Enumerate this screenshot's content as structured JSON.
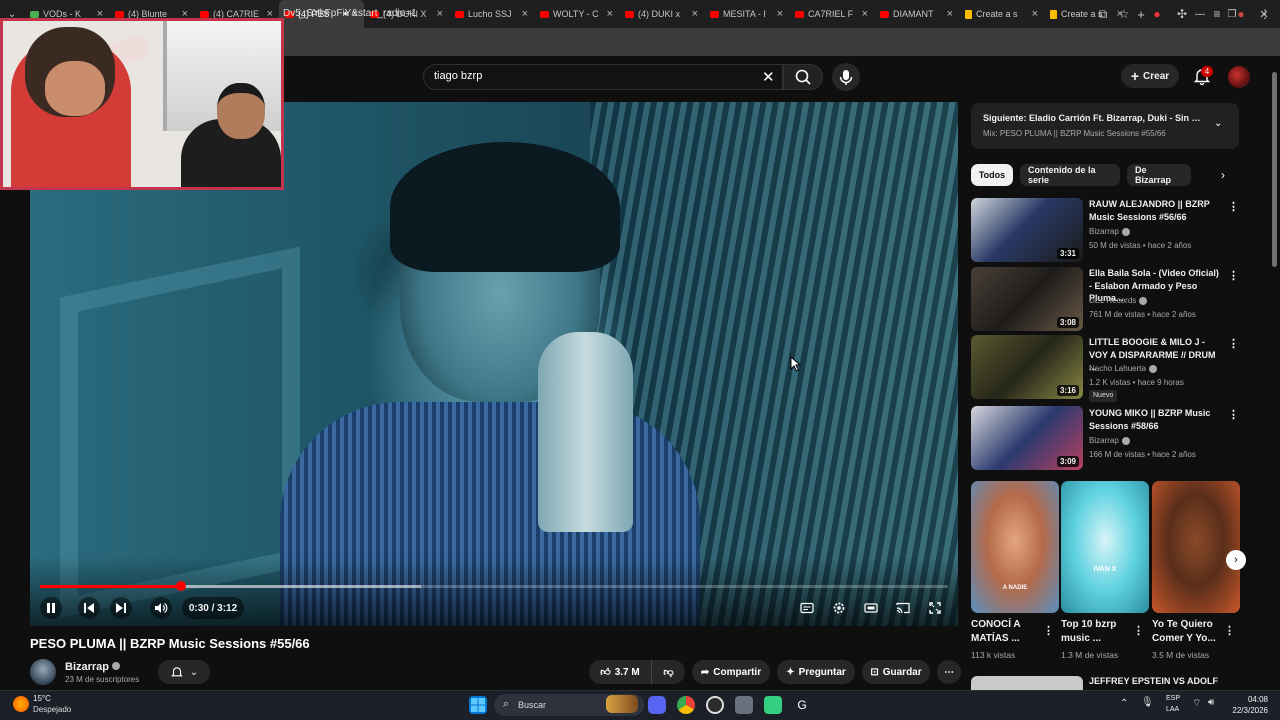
{
  "browser": {
    "tabs": [
      {
        "label": "VODs - K",
        "kind": "green"
      },
      {
        "label": "(4) Blunte",
        "kind": "yt"
      },
      {
        "label": "(4) CA7RIE",
        "kind": "yt"
      },
      {
        "label": "(4) PES",
        "kind": "yt",
        "active": true
      },
      {
        "label": "(4) DUKI X",
        "kind": "yt"
      },
      {
        "label": "Lucho SSJ",
        "kind": "yt"
      },
      {
        "label": "WOLTY - C",
        "kind": "yt"
      },
      {
        "label": "(4) DUKI x",
        "kind": "yt"
      },
      {
        "label": "MESITA - I",
        "kind": "yt"
      },
      {
        "label": "CA7RIEL F",
        "kind": "yt"
      },
      {
        "label": "DIAMANT",
        "kind": "yt"
      },
      {
        "label": "Create a s",
        "kind": "doc"
      },
      {
        "label": "Create a s",
        "kind": "doc"
      }
    ],
    "url": "Dv5_SYkFpFiY&start_radio=1",
    "new_tab": "+",
    "min": "—",
    "max": "❐",
    "close": "✕"
  },
  "youtube": {
    "search_query": "tiago bzrp",
    "create_label": "Crear",
    "notif_count": "4"
  },
  "player": {
    "current_time": "0:30",
    "duration": "3:12",
    "time_display": "0:30 / 3:12",
    "progress": 0.155,
    "buffered": 0.42
  },
  "video": {
    "title": "PESO PLUMA || BZRP Music Sessions #55/66",
    "channel": "Bizarrap",
    "subscribers": "23 M de suscriptores",
    "likes": "3.7 M",
    "share_label": "Compartir",
    "ask_label": "Preguntar",
    "save_label": "Guardar"
  },
  "sidebar": {
    "next_title": "Siguiente: Eladio Carrión Ft. Bizarrap, Duki - Sin Fre...",
    "next_sub": "Mix: PESO PLUMA || BZRP Music Sessions #55/66",
    "chips": [
      "Todos",
      "Contenido de la serie",
      "De Bizarrap"
    ],
    "recs": [
      {
        "title": "RAUW ALEJANDRO || BZRP Music Sessions #56/66",
        "channel": "Bizarrap",
        "meta": "50 M de vistas • hace 2 años",
        "duration": "3:31"
      },
      {
        "title": "Ella Baila Sola - (Video Oficial) - Eslabon Armado y Peso Pluma...",
        "channel": "DEL Records",
        "meta": "761 M de vistas • hace 2 años",
        "duration": "3:08"
      },
      {
        "title": "LITTLE BOOGIE & MILO J - VOY A DISPARARME // DRUM ...",
        "channel": "Nacho Lahuerta",
        "meta": "1.2 K vistas • hace 9 horas",
        "duration": "3:16",
        "badge": "Nuevo"
      },
      {
        "title": "YOUNG MIKO || BZRP Music Sessions #58/66",
        "channel": "Bizarrap",
        "meta": "166 M de vistas • hace 2 años",
        "duration": "3:09"
      }
    ],
    "shorts": [
      {
        "title": "CONOCÍ A MATÍAS ...",
        "views": "113 k vistas",
        "overlay": "A NADIE"
      },
      {
        "title": "Top 10 bzrp music ...",
        "views": "1.3 M de vistas",
        "overlay": "IVAN X"
      },
      {
        "title": "Yo Te Quiero Comer Y Yo...",
        "views": "3.5 M de vistas",
        "overlay": ""
      }
    ],
    "last_title": "JEFFREY EPSTEIN VS ADOLF"
  },
  "taskbar": {
    "temp": "15°C",
    "weather": "Despejado",
    "search_label": "Buscar",
    "lang1": "ESP",
    "lang2": "LAA",
    "time": "04:08",
    "date": "22/3/2026"
  },
  "colors": {
    "accent": "#ff0000",
    "bg": "#0f0f0f",
    "chip": "#272727"
  }
}
